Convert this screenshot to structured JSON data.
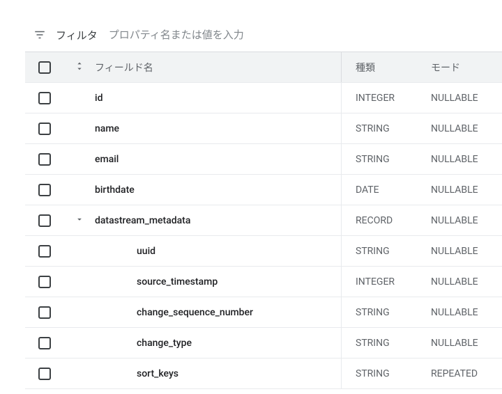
{
  "filter": {
    "label": "フィルタ",
    "placeholder": "プロパティ名または値を入力"
  },
  "header": {
    "field_name": "フィールド名",
    "type": "種類",
    "mode": "モード"
  },
  "rows": [
    {
      "name": "id",
      "type": "INTEGER",
      "mode": "NULLABLE",
      "indent": 0,
      "expand": false
    },
    {
      "name": "name",
      "type": "STRING",
      "mode": "NULLABLE",
      "indent": 0,
      "expand": false
    },
    {
      "name": "email",
      "type": "STRING",
      "mode": "NULLABLE",
      "indent": 0,
      "expand": false
    },
    {
      "name": "birthdate",
      "type": "DATE",
      "mode": "NULLABLE",
      "indent": 0,
      "expand": false
    },
    {
      "name": "datastream_metadata",
      "type": "RECORD",
      "mode": "NULLABLE",
      "indent": 0,
      "expand": true
    },
    {
      "name": "uuid",
      "type": "STRING",
      "mode": "NULLABLE",
      "indent": 1,
      "expand": false
    },
    {
      "name": "source_timestamp",
      "type": "INTEGER",
      "mode": "NULLABLE",
      "indent": 1,
      "expand": false
    },
    {
      "name": "change_sequence_number",
      "type": "STRING",
      "mode": "NULLABLE",
      "indent": 1,
      "expand": false
    },
    {
      "name": "change_type",
      "type": "STRING",
      "mode": "NULLABLE",
      "indent": 1,
      "expand": false
    },
    {
      "name": "sort_keys",
      "type": "STRING",
      "mode": "REPEATED",
      "indent": 1,
      "expand": false
    }
  ]
}
